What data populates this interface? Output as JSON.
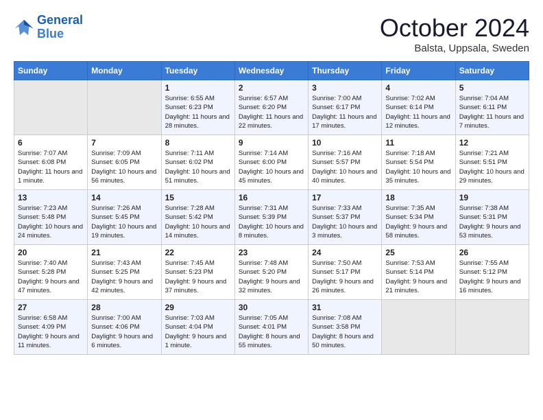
{
  "logo": {
    "line1": "General",
    "line2": "Blue"
  },
  "title": "October 2024",
  "location": "Balsta, Uppsala, Sweden",
  "days_of_week": [
    "Sunday",
    "Monday",
    "Tuesday",
    "Wednesday",
    "Thursday",
    "Friday",
    "Saturday"
  ],
  "weeks": [
    [
      {
        "day": "",
        "info": ""
      },
      {
        "day": "",
        "info": ""
      },
      {
        "day": "1",
        "info": "Sunrise: 6:55 AM\nSunset: 6:23 PM\nDaylight: 11 hours\nand 28 minutes."
      },
      {
        "day": "2",
        "info": "Sunrise: 6:57 AM\nSunset: 6:20 PM\nDaylight: 11 hours\nand 22 minutes."
      },
      {
        "day": "3",
        "info": "Sunrise: 7:00 AM\nSunset: 6:17 PM\nDaylight: 11 hours\nand 17 minutes."
      },
      {
        "day": "4",
        "info": "Sunrise: 7:02 AM\nSunset: 6:14 PM\nDaylight: 11 hours\nand 12 minutes."
      },
      {
        "day": "5",
        "info": "Sunrise: 7:04 AM\nSunset: 6:11 PM\nDaylight: 11 hours\nand 7 minutes."
      }
    ],
    [
      {
        "day": "6",
        "info": "Sunrise: 7:07 AM\nSunset: 6:08 PM\nDaylight: 11 hours\nand 1 minute."
      },
      {
        "day": "7",
        "info": "Sunrise: 7:09 AM\nSunset: 6:05 PM\nDaylight: 10 hours\nand 56 minutes."
      },
      {
        "day": "8",
        "info": "Sunrise: 7:11 AM\nSunset: 6:02 PM\nDaylight: 10 hours\nand 51 minutes."
      },
      {
        "day": "9",
        "info": "Sunrise: 7:14 AM\nSunset: 6:00 PM\nDaylight: 10 hours\nand 45 minutes."
      },
      {
        "day": "10",
        "info": "Sunrise: 7:16 AM\nSunset: 5:57 PM\nDaylight: 10 hours\nand 40 minutes."
      },
      {
        "day": "11",
        "info": "Sunrise: 7:18 AM\nSunset: 5:54 PM\nDaylight: 10 hours\nand 35 minutes."
      },
      {
        "day": "12",
        "info": "Sunrise: 7:21 AM\nSunset: 5:51 PM\nDaylight: 10 hours\nand 29 minutes."
      }
    ],
    [
      {
        "day": "13",
        "info": "Sunrise: 7:23 AM\nSunset: 5:48 PM\nDaylight: 10 hours\nand 24 minutes."
      },
      {
        "day": "14",
        "info": "Sunrise: 7:26 AM\nSunset: 5:45 PM\nDaylight: 10 hours\nand 19 minutes."
      },
      {
        "day": "15",
        "info": "Sunrise: 7:28 AM\nSunset: 5:42 PM\nDaylight: 10 hours\nand 14 minutes."
      },
      {
        "day": "16",
        "info": "Sunrise: 7:31 AM\nSunset: 5:39 PM\nDaylight: 10 hours\nand 8 minutes."
      },
      {
        "day": "17",
        "info": "Sunrise: 7:33 AM\nSunset: 5:37 PM\nDaylight: 10 hours\nand 3 minutes."
      },
      {
        "day": "18",
        "info": "Sunrise: 7:35 AM\nSunset: 5:34 PM\nDaylight: 9 hours\nand 58 minutes."
      },
      {
        "day": "19",
        "info": "Sunrise: 7:38 AM\nSunset: 5:31 PM\nDaylight: 9 hours\nand 53 minutes."
      }
    ],
    [
      {
        "day": "20",
        "info": "Sunrise: 7:40 AM\nSunset: 5:28 PM\nDaylight: 9 hours\nand 47 minutes."
      },
      {
        "day": "21",
        "info": "Sunrise: 7:43 AM\nSunset: 5:25 PM\nDaylight: 9 hours\nand 42 minutes."
      },
      {
        "day": "22",
        "info": "Sunrise: 7:45 AM\nSunset: 5:23 PM\nDaylight: 9 hours\nand 37 minutes."
      },
      {
        "day": "23",
        "info": "Sunrise: 7:48 AM\nSunset: 5:20 PM\nDaylight: 9 hours\nand 32 minutes."
      },
      {
        "day": "24",
        "info": "Sunrise: 7:50 AM\nSunset: 5:17 PM\nDaylight: 9 hours\nand 26 minutes."
      },
      {
        "day": "25",
        "info": "Sunrise: 7:53 AM\nSunset: 5:14 PM\nDaylight: 9 hours\nand 21 minutes."
      },
      {
        "day": "26",
        "info": "Sunrise: 7:55 AM\nSunset: 5:12 PM\nDaylight: 9 hours\nand 16 minutes."
      }
    ],
    [
      {
        "day": "27",
        "info": "Sunrise: 6:58 AM\nSunset: 4:09 PM\nDaylight: 9 hours\nand 11 minutes."
      },
      {
        "day": "28",
        "info": "Sunrise: 7:00 AM\nSunset: 4:06 PM\nDaylight: 9 hours\nand 6 minutes."
      },
      {
        "day": "29",
        "info": "Sunrise: 7:03 AM\nSunset: 4:04 PM\nDaylight: 9 hours\nand 1 minute."
      },
      {
        "day": "30",
        "info": "Sunrise: 7:05 AM\nSunset: 4:01 PM\nDaylight: 8 hours\nand 55 minutes."
      },
      {
        "day": "31",
        "info": "Sunrise: 7:08 AM\nSunset: 3:58 PM\nDaylight: 8 hours\nand 50 minutes."
      },
      {
        "day": "",
        "info": ""
      },
      {
        "day": "",
        "info": ""
      }
    ]
  ]
}
